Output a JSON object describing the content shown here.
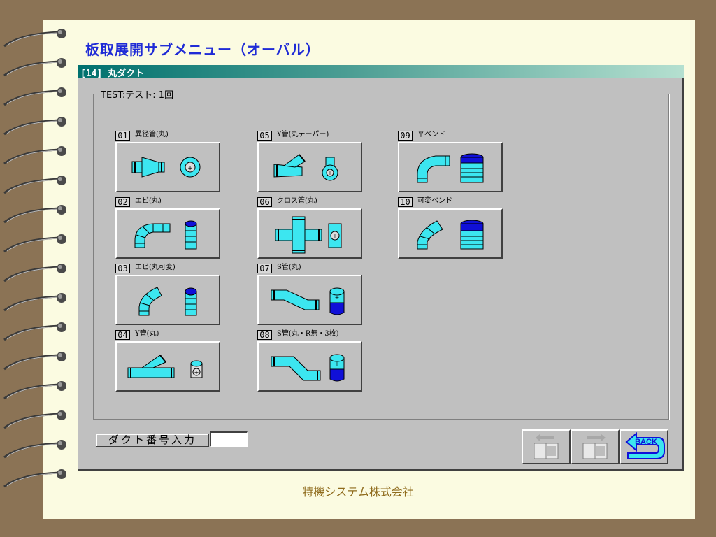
{
  "page_title": "板取展開サブメニュー（オーバル）",
  "window": {
    "title": "[14] 丸ダクト",
    "group_label": "TEST:テスト: 1回"
  },
  "items": [
    {
      "num": "01",
      "label": "異径管(丸)"
    },
    {
      "num": "02",
      "label": "エビ(丸)"
    },
    {
      "num": "03",
      "label": "エビ(丸可変)"
    },
    {
      "num": "04",
      "label": "Y管(丸)"
    },
    {
      "num": "05",
      "label": "Y管(丸テーパー)"
    },
    {
      "num": "06",
      "label": "クロス管(丸)"
    },
    {
      "num": "07",
      "label": "S管(丸)"
    },
    {
      "num": "08",
      "label": "S管(丸・R無・3枚)"
    },
    {
      "num": "09",
      "label": "平ベンド"
    },
    {
      "num": "10",
      "label": "可変ベンド"
    }
  ],
  "duct_number": {
    "label": "ダクト番号入力",
    "value": ""
  },
  "nav": {
    "back_label": "BACK"
  },
  "footer": "特機システム株式会社",
  "colors": {
    "duct_fill": "#3ce6f0",
    "duct_dark": "#1010d8",
    "window_bg": "#c0c0c0",
    "title_color": "#1f2bd6",
    "footer_color": "#8f6b1c"
  }
}
